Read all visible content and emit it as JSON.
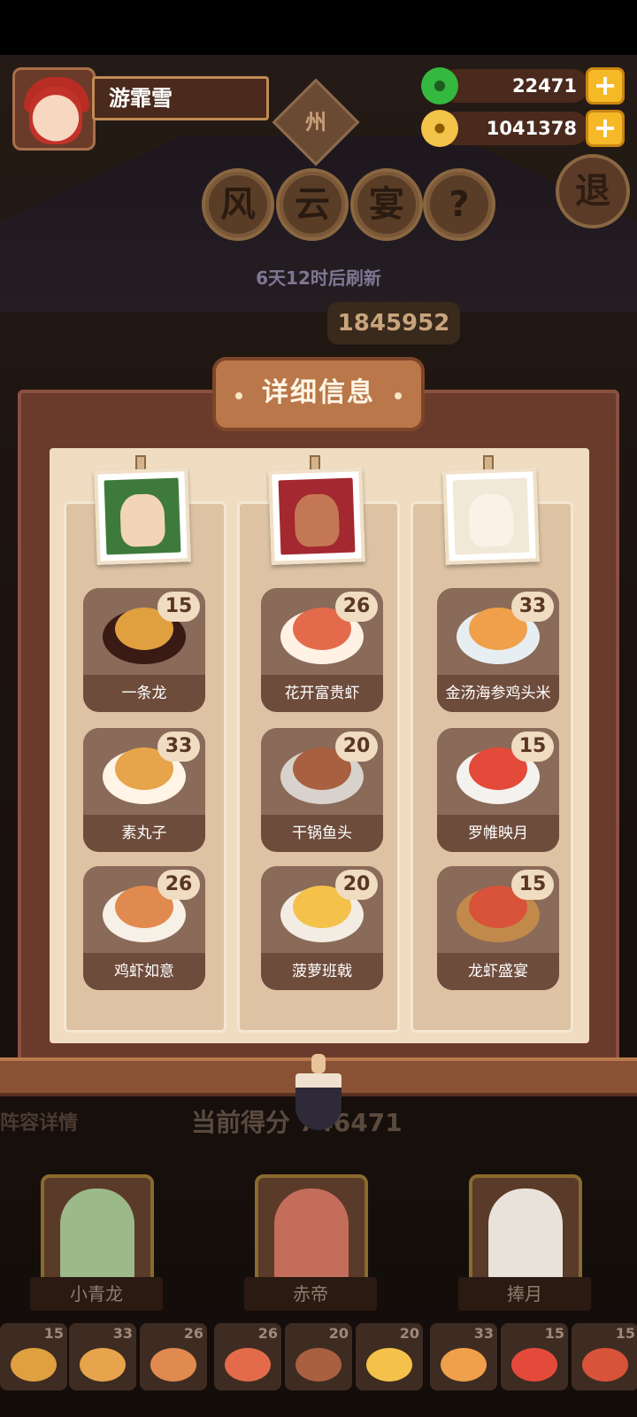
{
  "player": {
    "name": "游霏雪"
  },
  "currencies": [
    {
      "name": "jade",
      "value": "22471"
    },
    {
      "name": "coin",
      "value": "1041378"
    }
  ],
  "region_sign": "州",
  "title_chars": [
    "风",
    "云",
    "宴",
    "?"
  ],
  "exit_label": "退",
  "refresh_text": "6天12时后刷新",
  "top_score": "1845952",
  "modal": {
    "title": "详细信息",
    "columns": [
      {
        "hero": "小青龙",
        "dishes": [
          {
            "name": "一条龙",
            "count": "15"
          },
          {
            "name": "素丸子",
            "count": "33"
          },
          {
            "name": "鸡虾如意",
            "count": "26"
          }
        ]
      },
      {
        "hero": "赤帝",
        "dishes": [
          {
            "name": "花开富贵虾",
            "count": "26"
          },
          {
            "name": "干锅鱼头",
            "count": "20"
          },
          {
            "name": "菠萝班戟",
            "count": "20"
          }
        ]
      },
      {
        "hero": "捧月",
        "dishes": [
          {
            "name": "金汤海参鸡头米",
            "count": "33"
          },
          {
            "name": "罗帷映月",
            "count": "15"
          },
          {
            "name": "龙虾盛宴",
            "count": "15"
          }
        ]
      }
    ]
  },
  "background": {
    "lineup_label": "阵容详情",
    "current_score_label": "当前得分",
    "current_score_partial": "746471"
  },
  "heroes": [
    {
      "name": "小青龙"
    },
    {
      "name": "赤帝"
    },
    {
      "name": "捧月"
    }
  ],
  "mini_counts": [
    "15",
    "33",
    "26",
    "26",
    "20",
    "20",
    "33",
    "15",
    "15"
  ],
  "colors": {
    "accent": "#f5b928",
    "panel": "#f0dcc0",
    "frame": "#6a3a2c"
  }
}
